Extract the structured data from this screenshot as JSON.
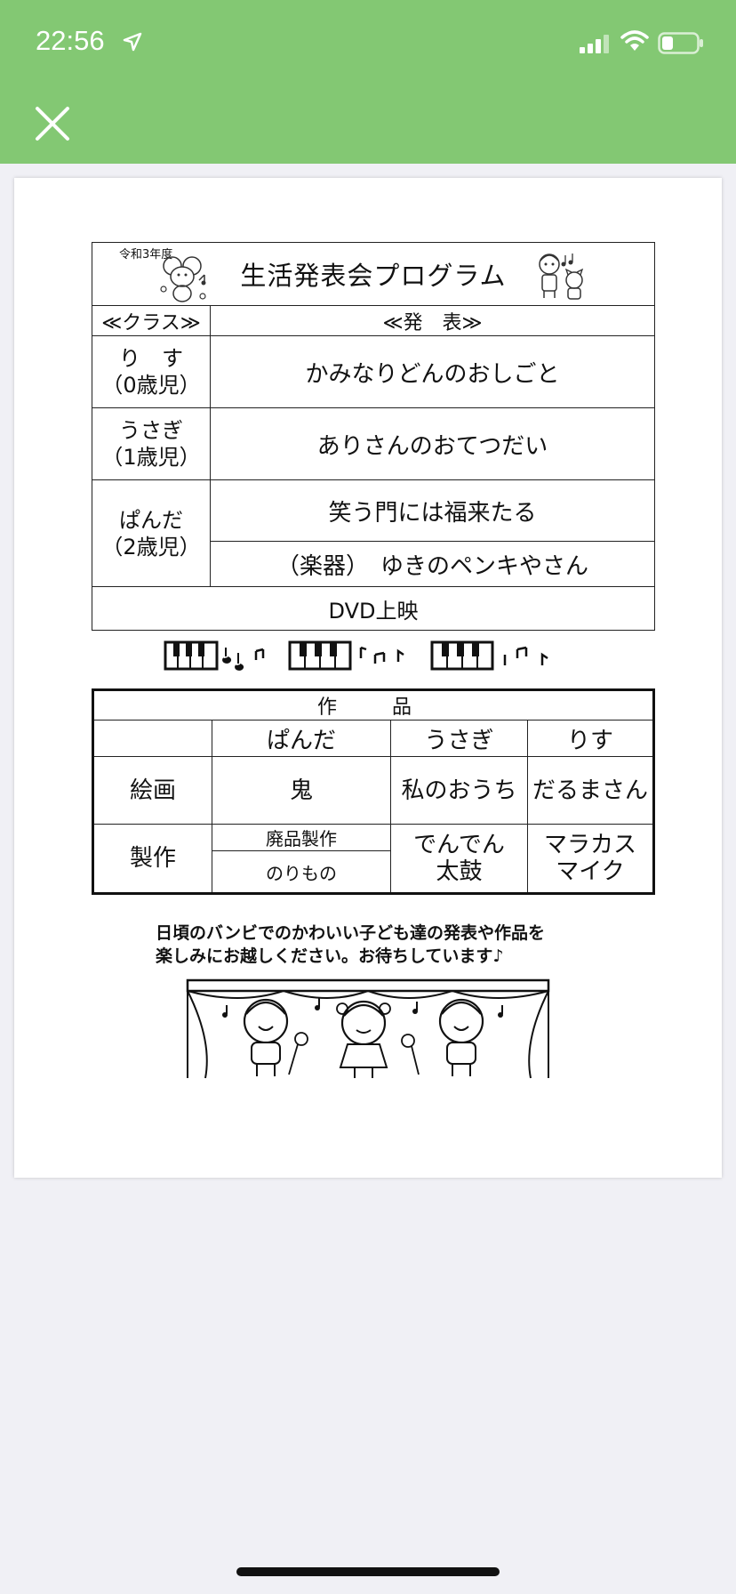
{
  "status_bar": {
    "time": "22:56"
  },
  "colors": {
    "topbar": "#83c873",
    "background": "#f0f0f5"
  },
  "header": {
    "close_icon": "close-icon"
  },
  "document": {
    "year": "令和3年度",
    "title": "生活発表会プログラム",
    "class_header": "≪クラス≫",
    "presentation_header": "≪発　表≫",
    "rows": [
      {
        "class_name": "り　す",
        "class_age": "（0歳児）",
        "presentation": "かみなりどんのおしごと"
      },
      {
        "class_name": "うさぎ",
        "class_age": "（1歳児）",
        "presentation": "ありさんのおてつだい"
      },
      {
        "class_name": "ぱんだ",
        "class_age": "（2歳児）",
        "presentation": "笑う門には福来たる",
        "presentation2": "（楽器）　ゆきのペンキやさん"
      }
    ],
    "dvd": "DVD上映",
    "works": {
      "title": "作　品",
      "columns": [
        "ぱんだ",
        "うさぎ",
        "りす"
      ],
      "painting_label": "絵画",
      "painting": [
        "鬼",
        "私のおうち",
        "だるまさん"
      ],
      "craft_label": "製作",
      "craft_panda_1": "廃品製作",
      "craft_panda_2": "のりもの",
      "craft_usagi_1": "でんでん",
      "craft_usagi_2": "太鼓",
      "craft_risu_1": "マラカス",
      "craft_risu_2": "マイク"
    },
    "message_line1": "日頃のバンビでのかわいい子ども達の発表や作品を",
    "message_line2": "楽しみにお越しください。お待ちしています♪"
  }
}
